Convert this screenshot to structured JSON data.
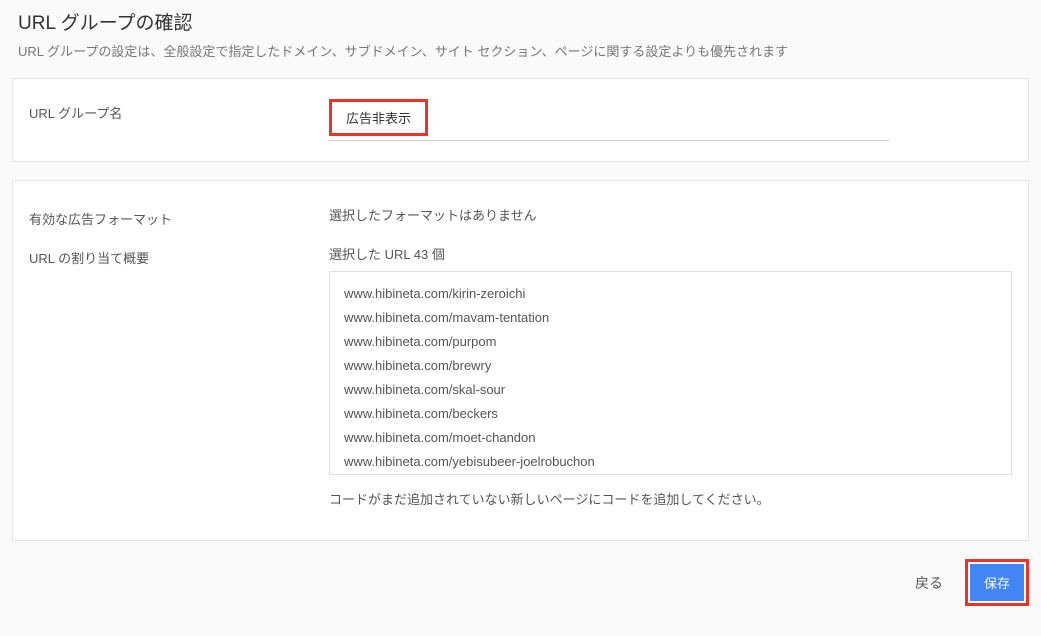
{
  "header": {
    "title": "URL グループの確認",
    "subtitle": "URL グループの設定は、全般設定で指定したドメイン、サブドメイン、サイト セクション、ページに関する設定よりも優先されます"
  },
  "group_name": {
    "label": "URL グループ名",
    "value": "広告非表示"
  },
  "ad_format": {
    "label": "有効な広告フォーマット",
    "value": "選択したフォーマットはありません"
  },
  "url_summary": {
    "label": "URL の割り当て概要",
    "count_text": "選択した URL 43 個",
    "hint": "コードがまだ追加されていない新しいページにコードを追加してください。",
    "urls": [
      "www.hibineta.com/kirin-zeroichi",
      "www.hibineta.com/mavam-tentation",
      "www.hibineta.com/purpom",
      "www.hibineta.com/brewry",
      "www.hibineta.com/skal-sour",
      "www.hibineta.com/beckers",
      "www.hibineta.com/moet-chandon",
      "www.hibineta.com/yebisubeer-joelrobuchon"
    ]
  },
  "footer": {
    "back": "戻る",
    "save": "保存"
  }
}
